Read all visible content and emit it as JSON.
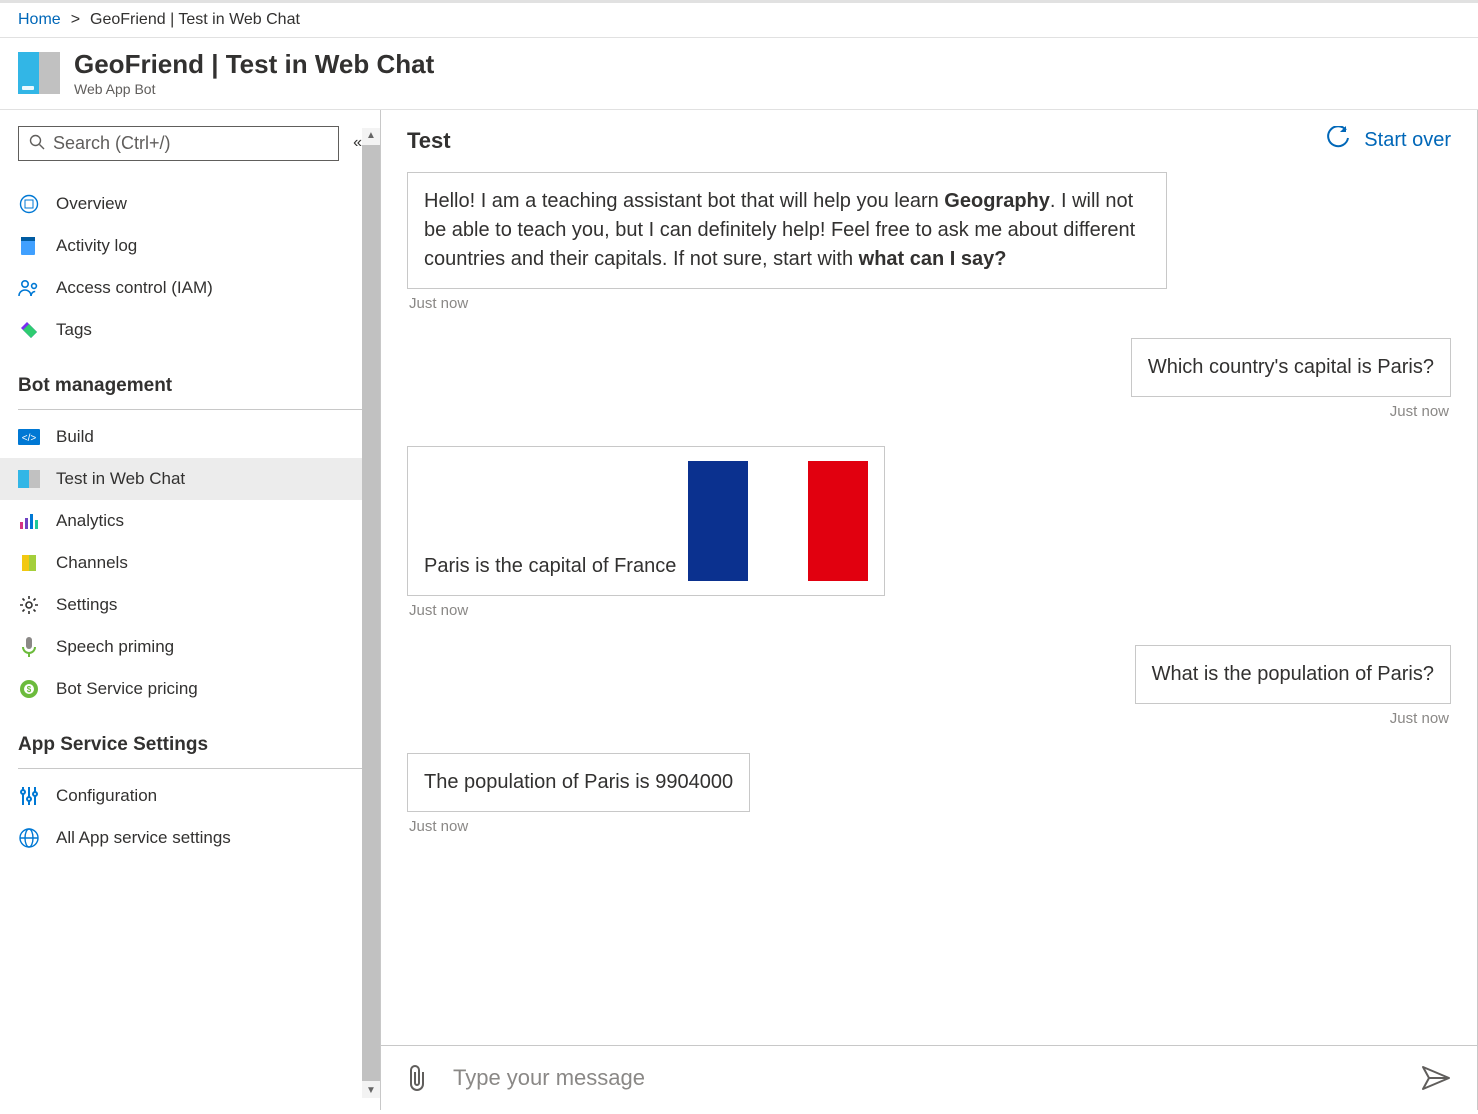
{
  "breadcrumb": {
    "home": "Home",
    "sep": ">",
    "current": "GeoFriend | Test in Web Chat"
  },
  "resource": {
    "title": "GeoFriend | Test in Web Chat",
    "subtitle": "Web App Bot"
  },
  "search": {
    "placeholder": "Search (Ctrl+/)"
  },
  "sidebar": {
    "items": [
      {
        "label": "Overview"
      },
      {
        "label": "Activity log"
      },
      {
        "label": "Access control (IAM)"
      },
      {
        "label": "Tags"
      }
    ],
    "group_bot": "Bot management",
    "bot_items": [
      {
        "label": "Build"
      },
      {
        "label": "Test in Web Chat"
      },
      {
        "label": "Analytics"
      },
      {
        "label": "Channels"
      },
      {
        "label": "Settings"
      },
      {
        "label": "Speech priming"
      },
      {
        "label": "Bot Service pricing"
      }
    ],
    "group_app": "App Service Settings",
    "app_items": [
      {
        "label": "Configuration"
      },
      {
        "label": "All App service settings"
      }
    ]
  },
  "chat": {
    "title": "Test",
    "start_over": "Start over",
    "composer_placeholder": "Type your message"
  },
  "messages": {
    "m0_pre": "Hello! I am a teaching assistant bot that will help you learn ",
    "m0_bold1": "Geography",
    "m0_mid1": ". I will not be able to teach you, but I can definitely help! Feel free to ask me about different countries and their capitals. If not sure, start with ",
    "m0_bold2": "what can I say?",
    "m0_time": "Just now",
    "m1_text": "Which country's capital is Paris?",
    "m1_time": "Just now",
    "m2_text": "Paris is the capital of France",
    "m2_time": "Just now",
    "m3_text": "What is the population of Paris?",
    "m3_time": "Just now",
    "m4_text": "The population of Paris is 9904000",
    "m4_time": "Just now"
  }
}
